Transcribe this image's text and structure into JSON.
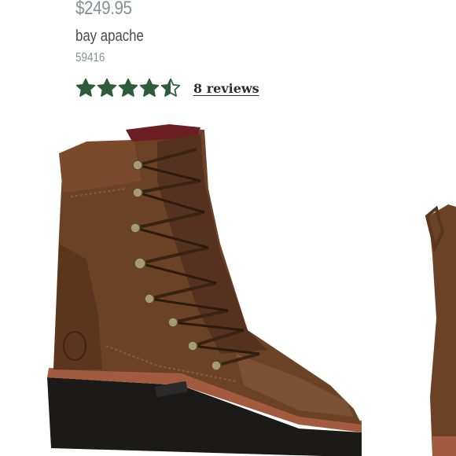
{
  "product": {
    "price": "$249.95",
    "color_name": "bay apache",
    "sku": "59416",
    "rating": 4.5,
    "rating_max": 5,
    "reviews_label": "8 reviews",
    "star_color": "#2e5b3a"
  },
  "images": {
    "main": "brown-leather-lace-up-work-boot",
    "thumbnail": "boot-side-view-partial"
  }
}
